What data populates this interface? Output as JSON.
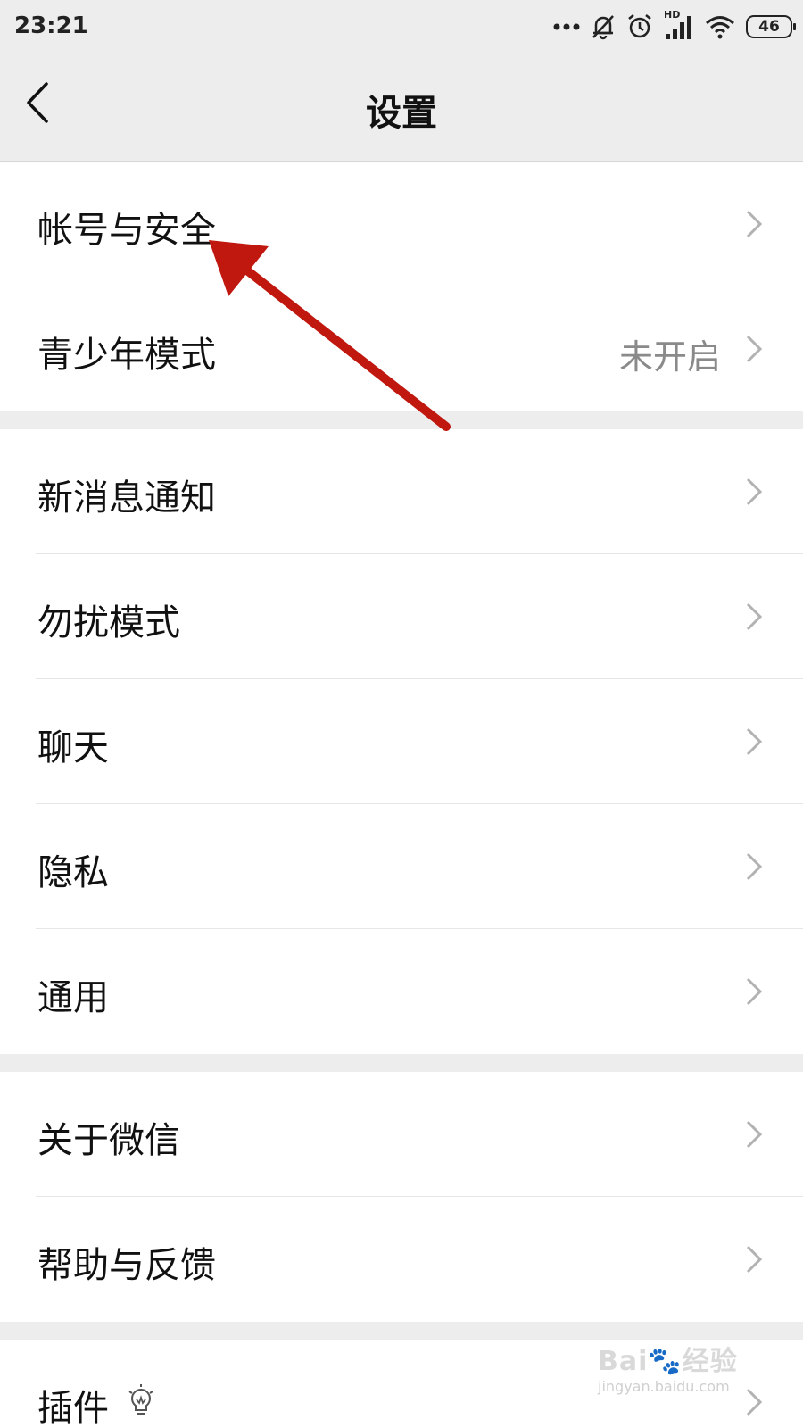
{
  "status": {
    "time": "23:21",
    "signal_label": "HD",
    "battery": "46",
    "icons": [
      "more-dots-icon",
      "bell-off-icon",
      "alarm-icon",
      "cellular-signal-icon",
      "wifi-icon",
      "battery-icon"
    ]
  },
  "nav": {
    "title": "设置",
    "back_icon": "chevron-left-icon"
  },
  "groups": [
    {
      "items": [
        {
          "label": "帐号与安全"
        },
        {
          "label": "青少年模式",
          "value": "未开启"
        }
      ]
    },
    {
      "items": [
        {
          "label": "新消息通知"
        },
        {
          "label": "勿扰模式"
        },
        {
          "label": "聊天"
        },
        {
          "label": "隐私"
        },
        {
          "label": "通用"
        }
      ]
    },
    {
      "items": [
        {
          "label": "关于微信"
        },
        {
          "label": "帮助与反馈"
        }
      ]
    },
    {
      "items": [
        {
          "label": "插件",
          "icon": "lightbulb-icon"
        }
      ]
    }
  ],
  "annotation": {
    "color": "#c0170f",
    "icon": "red-arrow-annotation"
  },
  "watermark": {
    "logo_a": "Bai",
    "logo_b": "经验",
    "url": "jingyan.baidu.com"
  },
  "colors": {
    "background": "#ededed",
    "card": "#ffffff",
    "muted_text": "#8a8a8a",
    "chevron": "#b2b2b2"
  }
}
